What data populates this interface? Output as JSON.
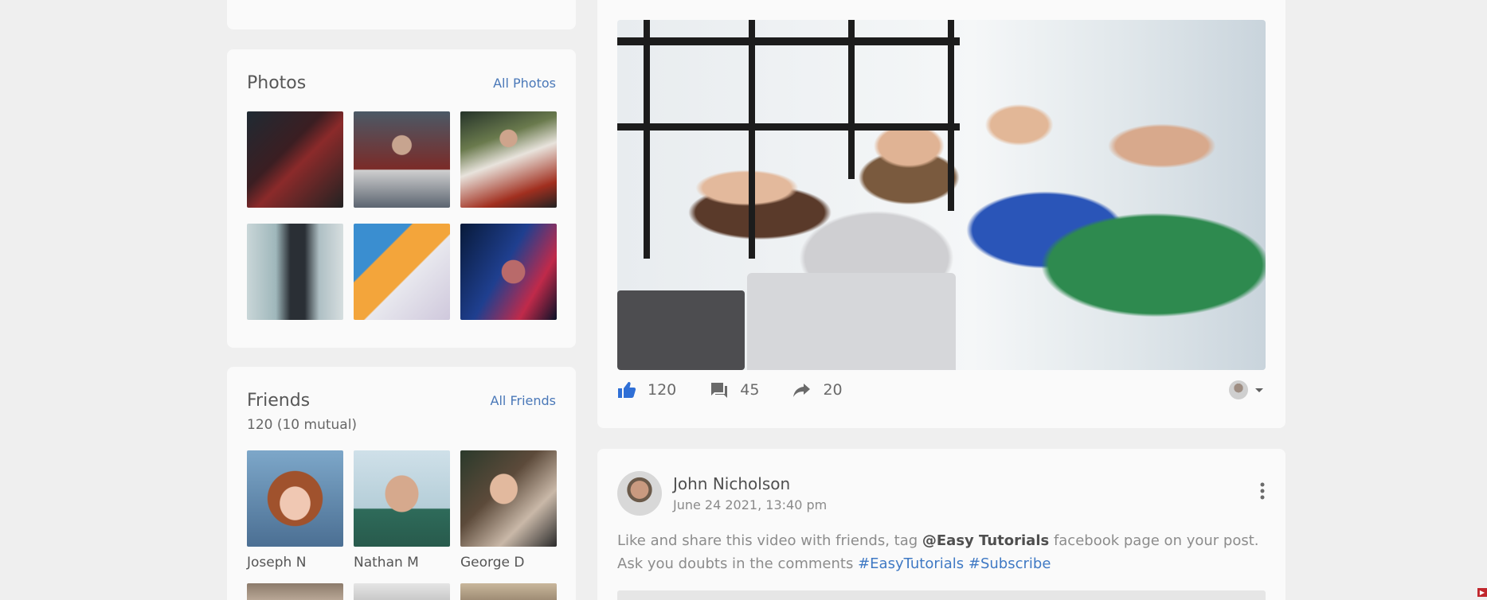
{
  "photos": {
    "title": "Photos",
    "all_link": "All Photos",
    "items": [
      "ph1",
      "ph2",
      "ph3",
      "ph4",
      "ph5",
      "ph6"
    ]
  },
  "friends": {
    "title": "Friends",
    "all_link": "All Friends",
    "count": "120 (10 mutual)",
    "items": [
      {
        "name": "Joseph N"
      },
      {
        "name": "Nathan M"
      },
      {
        "name": "George D"
      }
    ]
  },
  "post1": {
    "likes": "120",
    "comments": "45",
    "shares": "20"
  },
  "post2": {
    "author": "John Nicholson",
    "date": "June 24 2021, 13:40 pm",
    "text_before": "Like and share this video with friends, tag ",
    "mention": "@Easy Tutorials",
    "text_after": " facebook page on your post.",
    "line2_before": "Ask you doubts in the comments ",
    "tag1": "#EasyTutorials",
    "tag2": "#Subscribe"
  },
  "colors": {
    "accent": "#3f79c4",
    "like": "#2f6fd6",
    "background": "#efefef",
    "card": "#fafafa"
  },
  "icons": [
    "thumbs-up-icon",
    "comment-icon",
    "share-icon",
    "chevron-down-icon",
    "more-vertical-icon"
  ]
}
